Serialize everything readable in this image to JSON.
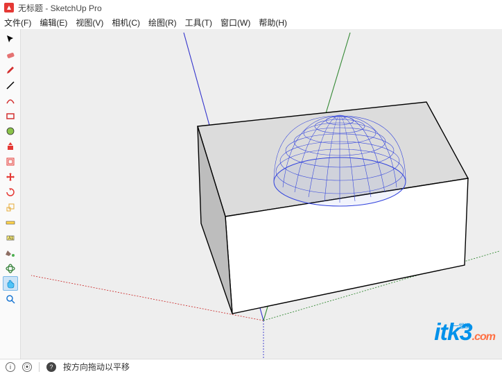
{
  "title": "无标题 - SketchUp Pro",
  "menu": {
    "file": "文件(F)",
    "edit": "编辑(E)",
    "view": "视图(V)",
    "camera": "相机(C)",
    "draw": "绘图(R)",
    "tools": "工具(T)",
    "window": "窗口(W)",
    "help": "帮助(H)"
  },
  "tools": [
    "select",
    "eraser",
    "pencil",
    "line",
    "arc",
    "rectangle",
    "circle",
    "pushpull",
    "offset",
    "move",
    "rotate",
    "scale",
    "tape",
    "text",
    "paint",
    "orbit",
    "pan",
    "zoom"
  ],
  "statusbar": {
    "hint": "按方向拖动以平移"
  },
  "watermark": {
    "brand": "itk3",
    "tld": ".com",
    "sub": "一堂课"
  }
}
